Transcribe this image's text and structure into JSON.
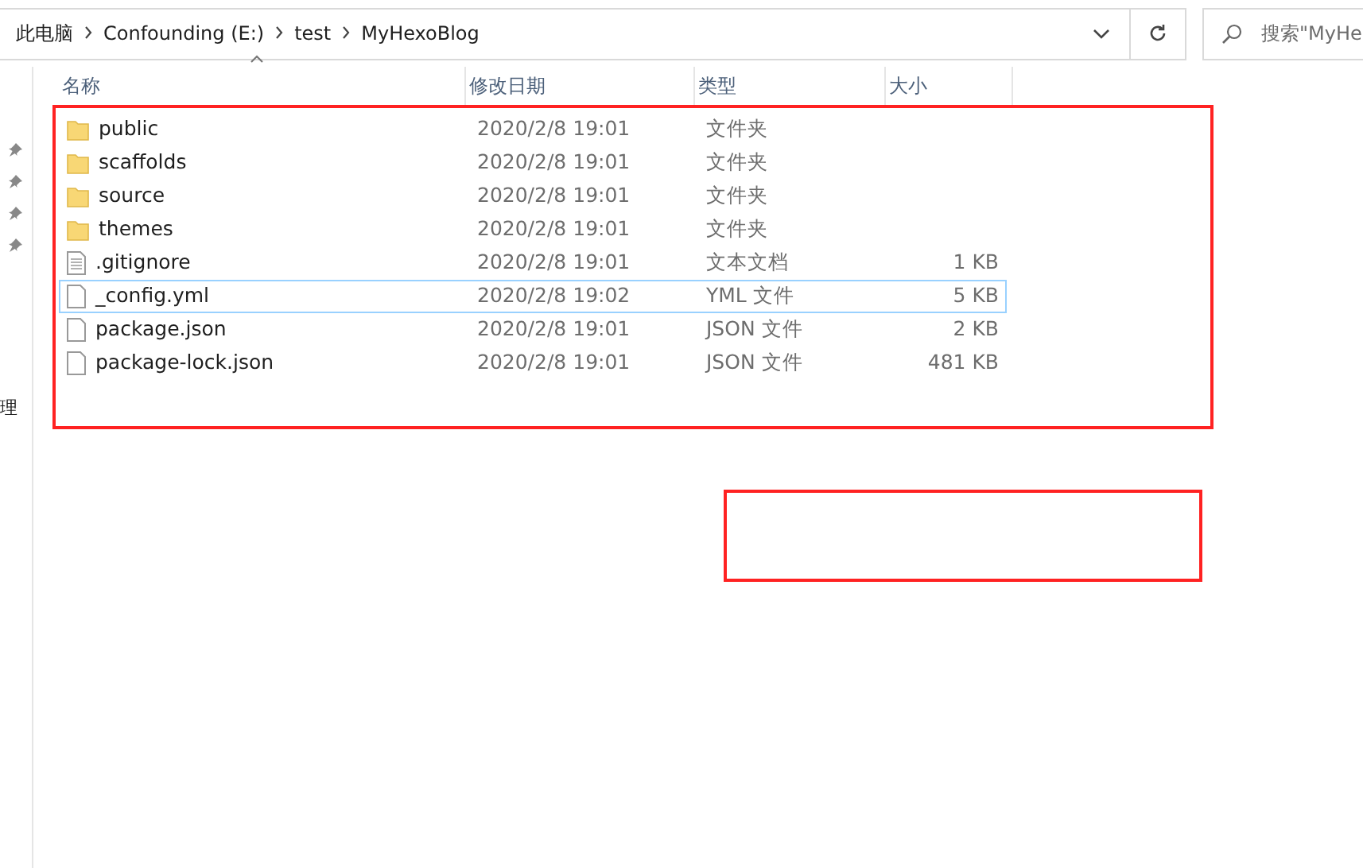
{
  "address_bar": {
    "breadcrumb": [
      "此电脑",
      "Confounding (E:)",
      "test",
      "MyHexoBlog"
    ],
    "search": {
      "placeholder": "搜索\"MyHe"
    }
  },
  "nav_pane": {
    "pinned_count_icons": [
      {
        "kind": "pin"
      },
      {
        "kind": "pin"
      },
      {
        "kind": "pin"
      },
      {
        "kind": "pin"
      }
    ],
    "cut_label": "理"
  },
  "columns": [
    "名称",
    "修改日期",
    "类型",
    "大小"
  ],
  "files": [
    {
      "kind": "folder",
      "name": "public",
      "date": "2020/2/8 19:01",
      "type": "文件夹",
      "focused": false
    },
    {
      "kind": "folder",
      "name": "scaffolds",
      "date": "2020/2/8 19:01",
      "type": "文件夹",
      "focused": false
    },
    {
      "kind": "folder",
      "name": "source",
      "date": "2020/2/8 19:01",
      "type": "文件夹",
      "focused": false
    },
    {
      "kind": "folder",
      "name": "themes",
      "date": "2020/2/8 19:01",
      "type": "文件夹",
      "focused": false
    },
    {
      "kind": "text",
      "name": ".gitignore",
      "date": "2020/2/8 19:01",
      "type": "文本文档",
      "size": "1 KB",
      "focused": false
    },
    {
      "kind": "file",
      "name": "_config.yml",
      "date": "2020/2/8 19:02",
      "type": "YML 文件",
      "size": "5 KB",
      "focused": true
    },
    {
      "kind": "file",
      "name": "package.json",
      "date": "2020/2/8 19:01",
      "type": "JSON 文件",
      "size": "2 KB",
      "focused": false
    },
    {
      "kind": "file",
      "name": "package-lock.json",
      "date": "2020/2/8 19:01",
      "type": "JSON 文件",
      "size": "481 KB",
      "focused": false
    }
  ],
  "annotations": [
    {
      "color": "#ff2222"
    },
    {
      "color": "#ff2222"
    }
  ]
}
